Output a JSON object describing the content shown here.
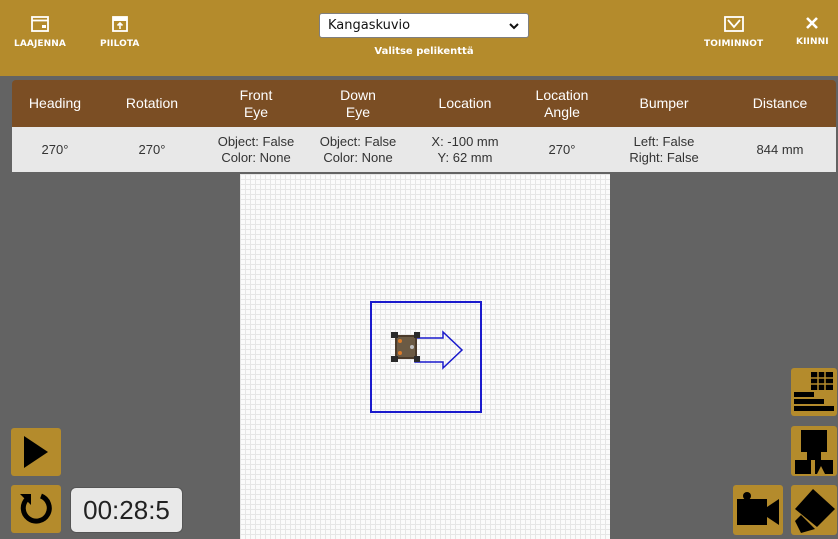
{
  "toolbar": {
    "expand_label": "LAAJENNA",
    "hide_label": "PIILOTA",
    "actions_label": "TOIMINNOT",
    "close_label": "KIINNI"
  },
  "field_select": {
    "selected": "Kangaskuvio",
    "caption": "Valitse pelikenttä"
  },
  "stats": {
    "headers": [
      "Heading",
      "Rotation",
      "Front\nEye",
      "Down\nEye",
      "Location",
      "Location\nAngle",
      "Bumper",
      "Distance"
    ],
    "values": [
      "270°",
      "270°",
      "Object: False\nColor: None",
      "Object: False\nColor: None",
      "X: -100 mm\nY: 62 mm",
      "270°",
      "Left: False\nRight: False",
      "844 mm"
    ]
  },
  "timer": "00:28:5",
  "colors": {
    "topbar": "#b48b2c",
    "stats_header": "#7b4e24",
    "background": "#636363",
    "path_blue": "#1a1acc"
  },
  "icons": [
    "expand-icon",
    "hide-icon",
    "actions-icon",
    "close-icon",
    "play-icon",
    "reset-icon",
    "table-icon",
    "robot-icon",
    "camera-icon",
    "eraser-icon"
  ]
}
